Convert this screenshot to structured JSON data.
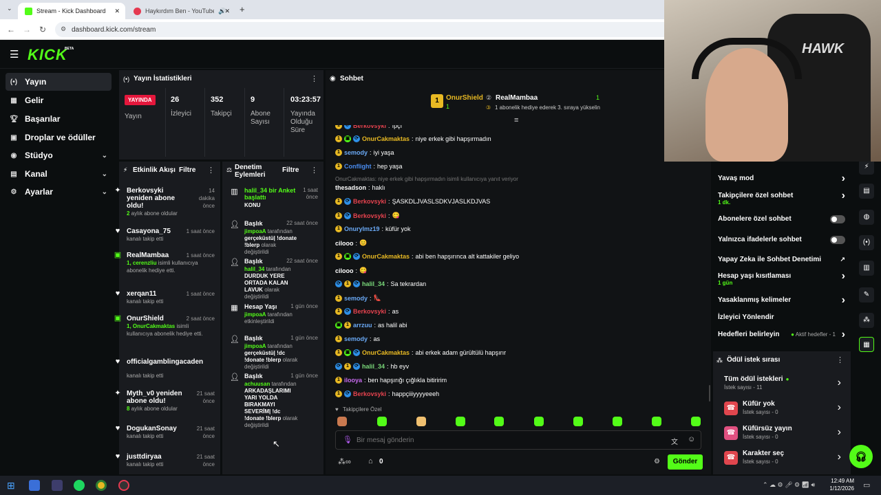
{
  "browser": {
    "tabs": [
      {
        "title": "Stream - Kick Dashboard"
      },
      {
        "title": "Haykırdım Ben - YouTube M"
      }
    ],
    "url": "dashboard.kick.com/stream"
  },
  "header": {
    "logo": "KICK",
    "beta": "BETA"
  },
  "sidebar": {
    "items": [
      {
        "label": "Yayın",
        "icon": "broadcast-icon"
      },
      {
        "label": "Gelir",
        "icon": "income-icon"
      },
      {
        "label": "Başarılar",
        "icon": "trophy-icon"
      },
      {
        "label": "Droplar ve ödüller",
        "icon": "gift-icon"
      },
      {
        "label": "Stüdyo",
        "icon": "camera-icon"
      },
      {
        "label": "Kanal",
        "icon": "channel-icon"
      },
      {
        "label": "Ayarlar",
        "icon": "gear-icon"
      }
    ]
  },
  "stats": {
    "title": "Yayın İstatistikleri",
    "live_badge": "YAYINDA",
    "live_label": "Yayın",
    "viewers": {
      "value": "26",
      "label": "İzleyici"
    },
    "followers": {
      "value": "352",
      "label": "Takipçi"
    },
    "subs": {
      "value": "9",
      "label": "Abone Sayısı"
    },
    "uptime": {
      "value": "03:23:57",
      "label": "Yayında Olduğu Süre"
    }
  },
  "activity": {
    "title": "Etkinlik Akışı",
    "filter": "Filtre",
    "events": [
      {
        "name": "Berkovsyki yeniden abone oldu!",
        "green": "2",
        "sub": " aylık abone oldular",
        "time": "14 dakika önce",
        "icon": "sparkle-icon"
      },
      {
        "name": "Casayona_75",
        "green": "",
        "sub": "kanalı takip etti",
        "time": "1 saat önce",
        "icon": "heart-icon"
      },
      {
        "name": "RealMambaa",
        "green": "1, cerenzliu",
        "sub": " isimli kullanıcıya abonelik hediye etti.",
        "time": "1 saat önce",
        "icon": "gift-icon"
      },
      {
        "name": "xerqan11",
        "green": "",
        "sub": "kanalı takip etti",
        "time": "1 saat önce",
        "icon": "heart-icon"
      },
      {
        "name": "OnurShield",
        "green": "1, OnurCakmaktas",
        "sub": " isimli kullanıcıya abonelik hediye etti.",
        "time": "2 saat önce",
        "icon": "gift-icon"
      },
      {
        "name": "officialgamblingacaden",
        "green": "",
        "sub": "kanalı takip etti",
        "time": "",
        "icon": "heart-icon"
      },
      {
        "name": "Myth_v0 yeniden abone oldu!",
        "green": "8",
        "sub": " aylık abone oldular",
        "time": "21 saat önce",
        "icon": "sparkle-icon"
      },
      {
        "name": "DogukanSonay",
        "green": "",
        "sub": "kanalı takip etti",
        "time": "21 saat önce",
        "icon": "heart-icon"
      },
      {
        "name": "justtdiryaa",
        "green": "",
        "sub": "kanalı takip etti",
        "time": "21 saat önce",
        "icon": "heart-icon"
      }
    ]
  },
  "moderation": {
    "title": "Denetim Eylemleri",
    "filter": "Filtre",
    "items": [
      {
        "head": "halil_34 bir Anket başlattı",
        "by": "",
        "mid": "",
        "val": "KONU",
        "time": "1 saat önce",
        "icon": "chart-icon"
      },
      {
        "head": "Başlık",
        "by": "jimpoaA",
        "mid": " tarafından ",
        "val": "gerçeküstü| !donate !blerp",
        "tail": " olarak değiştirildi",
        "time": "22 saat önce",
        "icon": "user-edit-icon"
      },
      {
        "head": "Başlık",
        "by": "halil_34",
        "mid": " tarafından ",
        "val": "DURDUK YERE ORTADA KALAN LAVUK",
        "tail": " olarak değiştirildi",
        "time": "22 saat önce",
        "icon": "user-edit-icon"
      },
      {
        "head": "Hesap Yaşı",
        "by": "jimpoaA",
        "mid": " tarafından ",
        "val": "",
        "tail": "etkinleştirildi",
        "time": "1 gün önce",
        "icon": "calendar-icon"
      },
      {
        "head": "Başlık",
        "by": "jimpoaA",
        "mid": " tarafından ",
        "val": "gerçeküstü| !dc !donate !blerp",
        "tail": " olarak değiştirildi",
        "time": "1 gün önce",
        "icon": "user-edit-icon"
      },
      {
        "head": "Başlık",
        "by": "achuusan",
        "mid": " tarafından ",
        "val": "ARKADAŞLARIMI YARI YOLDA BIRAKMAYI SEVERİM| !dc !donate !blerp",
        "tail": " olarak değiştirildi",
        "time": "1 gün önce",
        "icon": "user-edit-icon"
      }
    ]
  },
  "chat": {
    "title": "Sohbet",
    "pinned": {
      "left_name": "OnurShield",
      "left_count": "1",
      "right_name": "RealMambaa",
      "right_count": "1",
      "right_sub": "1 abonelik hediye ederek 3. sıraya yükselin"
    },
    "messages": [
      {
        "user": "Berkovsyki",
        "color": "#e5424e",
        "text": "ıpçı",
        "badges": [
          "gold",
          "blue"
        ]
      },
      {
        "user": "OnurCakmaktas",
        "color": "#e8b923",
        "text": "niye erkek gibi hapşırmadın",
        "badges": [
          "gold",
          "green",
          "blue"
        ]
      },
      {
        "user": "semody",
        "color": "#6aa9f5",
        "text": "iyi yaşa",
        "badges": [
          "gold"
        ]
      },
      {
        "user": "Conflight",
        "color": "#4a8cf0",
        "text": "hep yaşa",
        "badges": [
          "gold"
        ]
      },
      {
        "reply": "OnurCakmaktas: niye erkek gibi hapşırmadın isimli kullanıcıya yanıt veriyor",
        "user": "thesadson",
        "color": "#ffffff",
        "text": "haklı",
        "badges": []
      },
      {
        "user": "Berkovsyki",
        "color": "#e5424e",
        "text": "ŞASKDLJVASLSDKVJASLKDJVAS",
        "badges": [
          "gold",
          "blue"
        ]
      },
      {
        "user": "Berkovsyki",
        "color": "#e5424e",
        "text": "😋",
        "badges": [
          "gold",
          "blue"
        ]
      },
      {
        "user": "Onurylmz19",
        "color": "#6aa9f5",
        "text": "küfür yok",
        "badges": [
          "gold"
        ]
      },
      {
        "user": "cilooo",
        "color": "#ffffff",
        "text": "😊",
        "badges": []
      },
      {
        "user": "OnurCakmaktas",
        "color": "#e8b923",
        "text": "abi ben hapşırınca alt kattakiler geliyo",
        "badges": [
          "gold",
          "green",
          "blue"
        ]
      },
      {
        "user": "cilooo",
        "color": "#ffffff",
        "text": "😋",
        "badges": []
      },
      {
        "user": "halil_34",
        "color": "#7ad97a",
        "text": "Sa tekrardan",
        "badges": [
          "blue",
          "gold",
          "blue"
        ]
      },
      {
        "user": "semody",
        "color": "#6aa9f5",
        "text": "👠",
        "badges": [
          "gold"
        ]
      },
      {
        "user": "Berkovsyki",
        "color": "#e5424e",
        "text": "as",
        "badges": [
          "gold",
          "blue"
        ]
      },
      {
        "user": "arrzuu",
        "color": "#6aa9f5",
        "text": "as halil abi",
        "badges": [
          "green",
          "gold"
        ]
      },
      {
        "user": "semody",
        "color": "#6aa9f5",
        "text": "as",
        "badges": [
          "gold"
        ]
      },
      {
        "user": "OnurCakmaktas",
        "color": "#e8b923",
        "text": "abi erkek adam gürültülü hapşırır",
        "badges": [
          "gold",
          "green",
          "blue"
        ]
      },
      {
        "user": "halil_34",
        "color": "#7ad97a",
        "text": "hb eyv",
        "badges": [
          "blue",
          "gold",
          "blue"
        ]
      },
      {
        "user": "ilooya",
        "color": "#c96cf0",
        "text": "ben hapşırığı çığlıkla bitiririm",
        "badges": [
          "gold"
        ]
      },
      {
        "user": "Berkovsyki",
        "color": "#e5424e",
        "text": "happçiiiyyyyeeeh",
        "badges": [
          "gold",
          "blue"
        ]
      }
    ],
    "emote_section": "Takipçilere Özel",
    "input_placeholder": "Bir mesaj gönderin",
    "points": "0",
    "send": "Gönder"
  },
  "settings": {
    "rows": [
      {
        "label": "Yavaş mod",
        "sub": "",
        "ctrl": "chevron"
      },
      {
        "label": "Takipçilere özel sohbet",
        "sub": "1 dk.",
        "ctrl": "chevron"
      },
      {
        "label": "Abonelere özel sohbet",
        "sub": "",
        "ctrl": "toggle"
      },
      {
        "label": "Yalnızca ifadelerle sohbet",
        "sub": "",
        "ctrl": "toggle"
      },
      {
        "label": "Yapay Zeka ile Sohbet Denetimi",
        "sub": "",
        "ctrl": "external"
      },
      {
        "label": "Hesap yaşı kısıtlaması",
        "sub": "1 gün",
        "ctrl": "chevron"
      },
      {
        "label": "Yasaklanmış kelimeler",
        "sub": "",
        "ctrl": "chevron"
      },
      {
        "label": "İzleyici Yönlendir",
        "sub": "",
        "ctrl": "none"
      },
      {
        "label": "Hedefleri belirleyin",
        "sub": "",
        "ctrl": "chevron",
        "status": "Aktif hedefler - 1"
      }
    ]
  },
  "rewards": {
    "title": "Ödül istek sırası",
    "items": [
      {
        "label": "Tüm ödül istekleri",
        "count": "İstek sayısı - 11"
      },
      {
        "label": "Küfür yok",
        "count": "İstek sayısı - 0"
      },
      {
        "label": "Küfürsüz yayın",
        "count": "İstek sayısı - 0"
      },
      {
        "label": "Karakter seç",
        "count": "İstek sayısı - 0"
      }
    ]
  },
  "taskbar": {
    "time": "12:49 AM",
    "date": "1/12/2026"
  },
  "colors": {
    "accent": "#53fc18",
    "live": "#e5173c",
    "panel": "#191b1f"
  }
}
